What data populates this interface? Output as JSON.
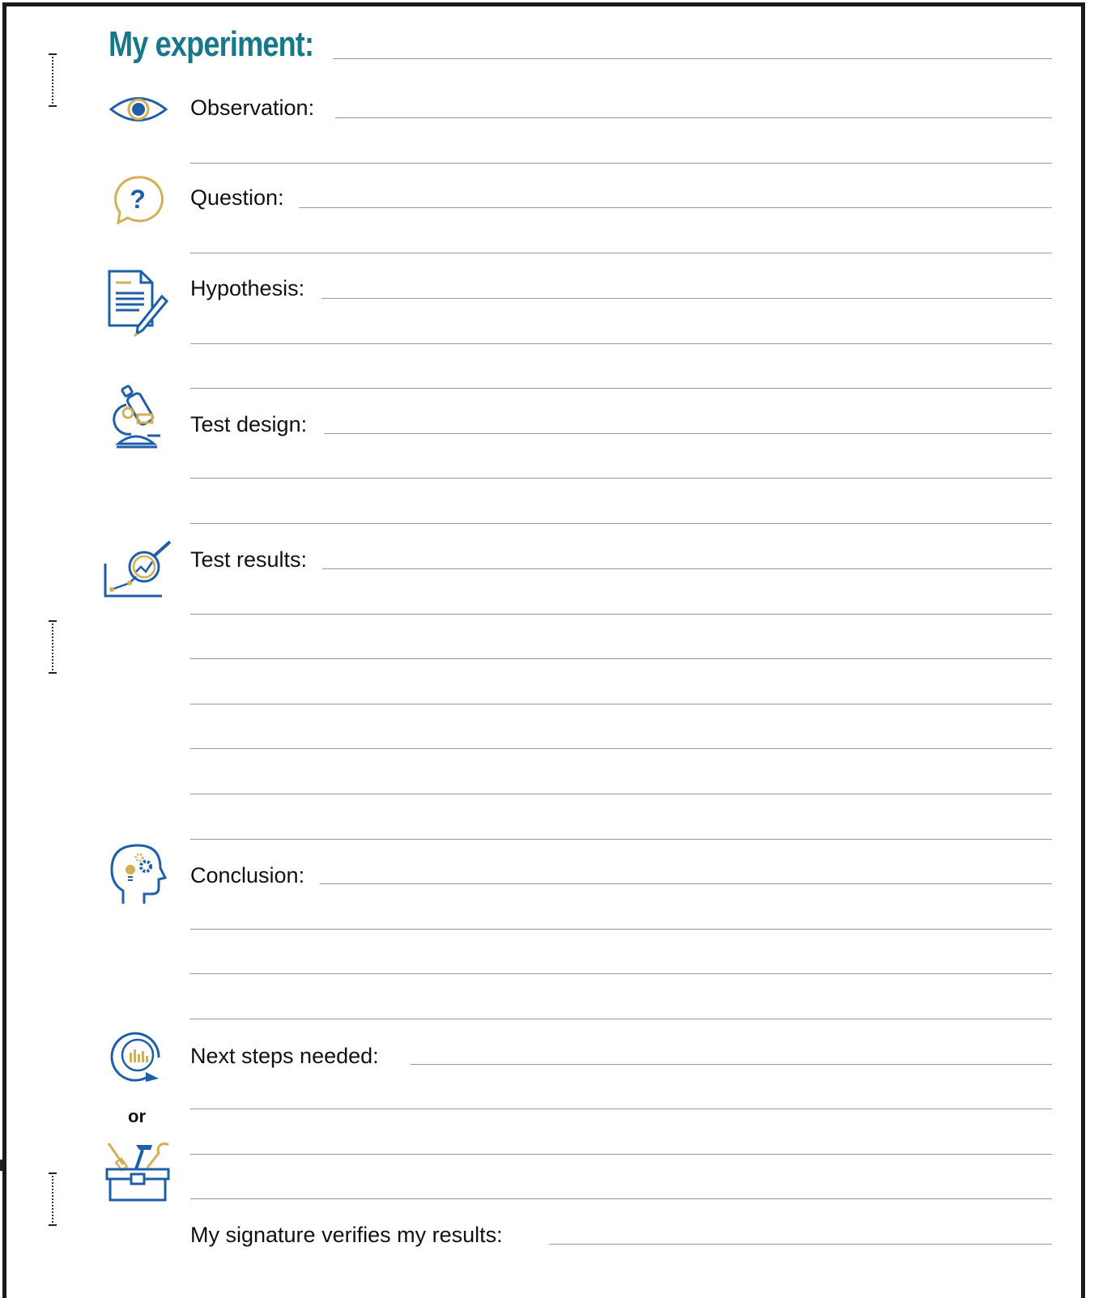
{
  "header": {
    "title": "My experiment:"
  },
  "sections": {
    "observation": {
      "label": "Observation:"
    },
    "question": {
      "label": "Question:"
    },
    "hypothesis": {
      "label": "Hypothesis:"
    },
    "test_design": {
      "label": "Test design:"
    },
    "test_results": {
      "label": "Test results:"
    },
    "conclusion": {
      "label": "Conclusion:"
    },
    "next_steps": {
      "label": "Next steps needed:"
    },
    "or_text": "or",
    "signature": {
      "label": "My signature verifies my results:"
    }
  },
  "colors": {
    "accent": "#17788c",
    "icon_blue": "#1f5ea8",
    "icon_gold": "#d4b055",
    "rule": "#9a9a9a"
  },
  "icons": [
    "eye-icon",
    "question-bubble-icon",
    "document-pencil-icon",
    "microscope-icon",
    "chart-magnifier-icon",
    "head-lightbulb-gears-icon",
    "cycle-chart-icon",
    "toolbox-icon"
  ]
}
